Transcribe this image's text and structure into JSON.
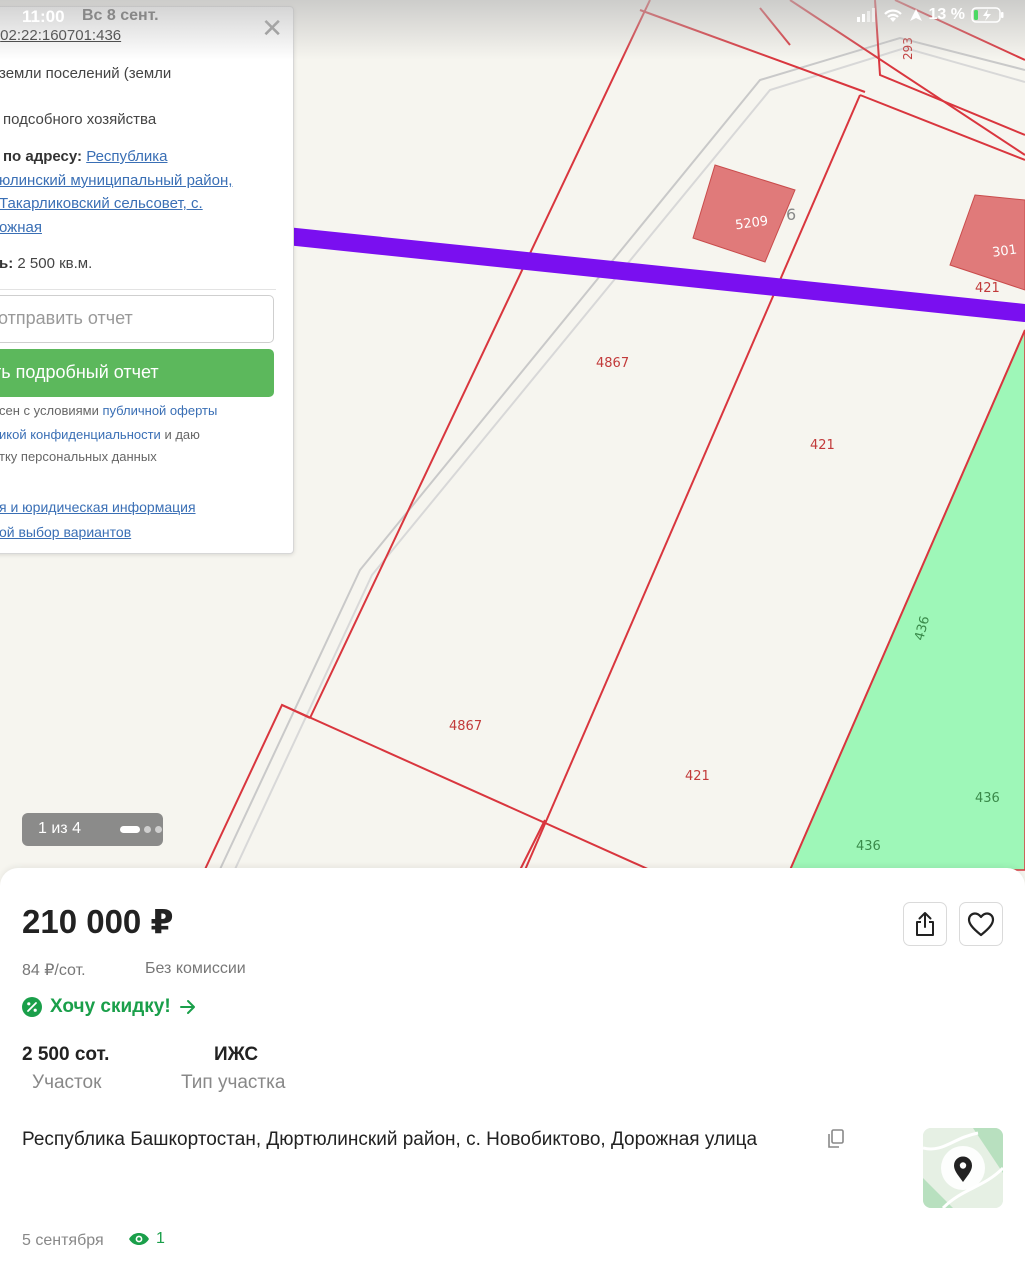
{
  "status_bar": {
    "time": "11:00",
    "date": "Вс 8 сент.",
    "battery_percent": "13 %"
  },
  "map_panel": {
    "cadastral_prefix": ":",
    "cadastral_number": "02:22:160701:436",
    "land_category": "земли поселений (земли",
    "land_use": "подсобного хозяйства",
    "address_label": "по адресу:",
    "address_line1": "Республика",
    "address_line2": "юлинский муниципальный район,",
    "address_line3": "Такарликовский сельсовет, с.",
    "address_line4": "ожная",
    "area_label": "ь:",
    "area_value": "2 500 кв.м.",
    "send_report": "отправить отчет",
    "get_report": "ть подробный отчет",
    "terms_line1_a": "сен с условиями ",
    "terms_line1_b": "публичной оферты",
    "terms_line2_a": "икой конфиденциальности",
    "terms_line2_b": " и даю",
    "terms_line3": "тку персональных данных",
    "legal_info": "я и юридическая информация",
    "variants": "ой выбор вариантов"
  },
  "map_labels": {
    "plot_5209": "5209",
    "plot_301": "301",
    "plot_293": "293",
    "digit_6": "6",
    "l421a": "421",
    "l4867a": "4867",
    "l421b": "421",
    "l436a": "436",
    "l4867b": "4867",
    "l421c": "421",
    "l436b": "436",
    "l436c": "436"
  },
  "gallery": {
    "counter": "1 из 4",
    "total": 4,
    "current": 1
  },
  "listing": {
    "price": "210 000 ₽",
    "price_per_unit": "84 ₽/сот.",
    "commission": "Без комиссии",
    "discount_label": "Хочу скидку!",
    "params": [
      {
        "value": "2 500 сот.",
        "label": "Участок"
      },
      {
        "value": "ИЖС",
        "label": "Тип участка"
      }
    ],
    "address": "Республика Башкортостан, Дюртюлинский район, с. Новобиктово, Дорожная улица",
    "date": "5 сентября",
    "views": "1"
  },
  "colors": {
    "accent_green": "#1a9f4a",
    "button_green": "#5cb85c",
    "plot_line": "#d9363e",
    "plot_fill": "#e07a7a",
    "forest_fill": "#9ef7b8",
    "route_line": "#7a0ff0"
  },
  "icons": {
    "share": "share-icon",
    "favorite": "heart-icon",
    "discount": "percent-badge-icon",
    "arrow": "arrow-right-icon",
    "copy": "copy-icon",
    "views": "eye-icon",
    "map_pin": "map-pin-icon"
  }
}
